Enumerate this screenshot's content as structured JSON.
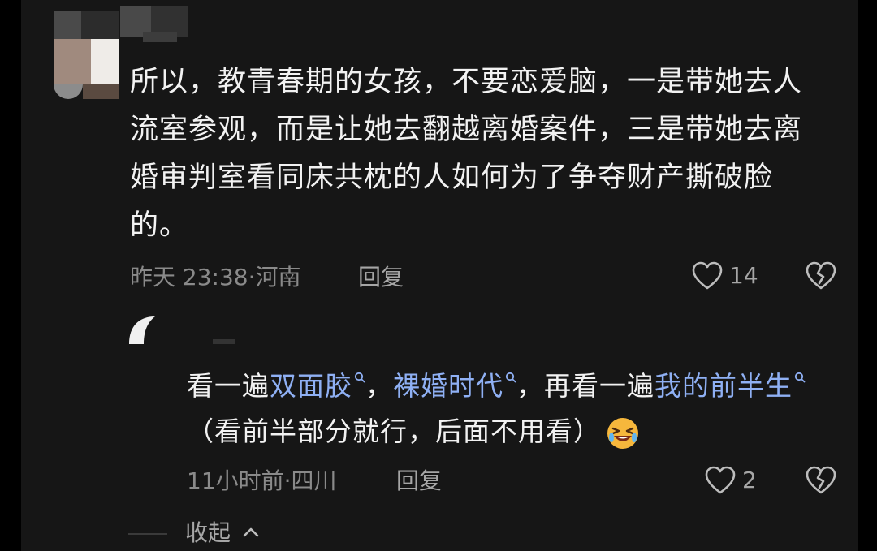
{
  "comment": {
    "text": "所以，教青春期的女孩，不要恋爱脑，一是带她去人流室参观，而是让她去翻越离婚案件，三是带她去离婚审判室看同床共枕的人如何为了争夺财产撕破脸的。",
    "time": "昨天 23:38",
    "sep": "·",
    "location": "河南",
    "reply_label": "回复",
    "likes": "14"
  },
  "reply": {
    "segments": [
      {
        "text": "看一遍",
        "type": "text"
      },
      {
        "text": "双面胶",
        "type": "keyword"
      },
      {
        "text": "，",
        "type": "text"
      },
      {
        "text": "裸婚时代",
        "type": "keyword"
      },
      {
        "text": "，再看一遍",
        "type": "text"
      },
      {
        "text": "我的前半生",
        "type": "keyword"
      },
      {
        "text": "（看前半部分就行，后面不用看）",
        "type": "text"
      }
    ],
    "time": "11小时前",
    "sep": "·",
    "location": "四川",
    "reply_label": "回复",
    "likes": "2"
  },
  "collapse_label": "收起",
  "icons": {
    "like": "heart-outline-icon",
    "dislike": "broken-heart-icon",
    "keyword_search": "search-icon",
    "emoji": "laughing-crying-emoji-icon",
    "collapse": "chevron-up-icon"
  },
  "colors": {
    "background": "#161616",
    "text": "#f2f2f2",
    "meta": "#8a8a8a",
    "keyword": "#8fb0f4"
  }
}
